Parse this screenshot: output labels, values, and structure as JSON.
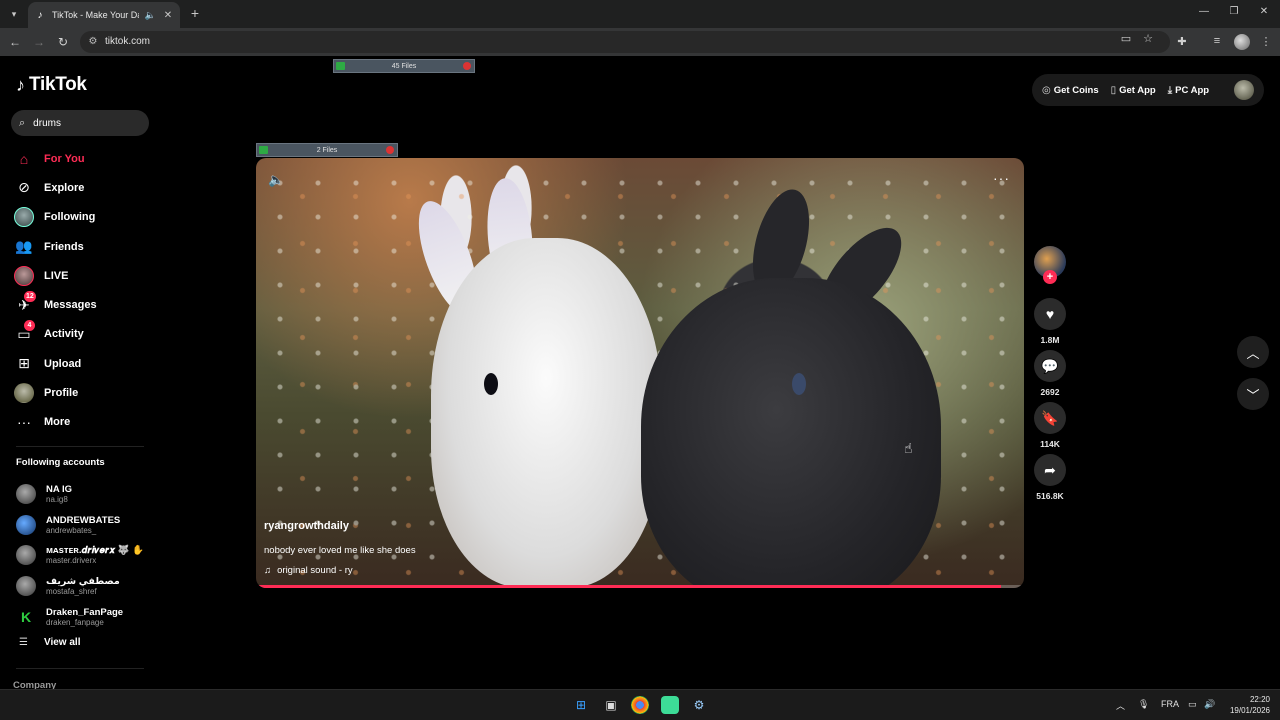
{
  "browser": {
    "tab_title": "TikTok - Make Your Day",
    "url": "tiktok.com"
  },
  "tiktok": {
    "logo_text": "TikTok",
    "search_value": "drums",
    "nav": [
      {
        "label": "For You",
        "icon": "home-icon"
      },
      {
        "label": "Explore",
        "icon": "compass-icon"
      },
      {
        "label": "Following",
        "icon": "following-avatar-icon"
      },
      {
        "label": "Friends",
        "icon": "friends-icon"
      },
      {
        "label": "LIVE",
        "icon": "live-avatar-icon"
      },
      {
        "label": "Messages",
        "icon": "messages-icon",
        "badge": "12"
      },
      {
        "label": "Activity",
        "icon": "activity-icon",
        "badge": "4"
      },
      {
        "label": "Upload",
        "icon": "upload-icon"
      },
      {
        "label": "Profile",
        "icon": "profile-avatar-icon"
      },
      {
        "label": "More",
        "icon": "more-dots-icon"
      }
    ],
    "following_accounts_title": "Following accounts",
    "following_accounts": [
      {
        "name": "NA IG",
        "handle": "na.ig8"
      },
      {
        "name": "ANDREWBATES",
        "handle": "andrewbates_"
      },
      {
        "name": "ᴍᴀsᴛᴇʀ.𝒅𝒓𝒊𝒗𝒆𝒓𝒙 🐺 ✋",
        "handle": "master.driverx"
      },
      {
        "name": "مصطفي شريف",
        "handle": "mostafa_shref"
      },
      {
        "name": "Draken_FanPage",
        "handle": "draken_fanpage"
      }
    ],
    "view_all": "View all",
    "company": "Company",
    "top_actions": {
      "get_coins": "Get Coins",
      "get_app": "Get App",
      "pc_app": "PC App"
    },
    "overlay_top": "45 Files",
    "overlay_video": "2 Files",
    "video": {
      "author": "ryangrowthdaily",
      "caption": "nobody ever loved me like she does",
      "sound": "original sound - ry",
      "progress": 0.97
    },
    "actions": {
      "likes": "1.8M",
      "comments": "2692",
      "saves": "114K",
      "shares": "516.8K"
    }
  },
  "taskbar": {
    "language": "FRA",
    "time": "22:20",
    "date": "19/01/2026"
  },
  "colors": {
    "accent": "#fe2c55",
    "page_bg": "#000000"
  }
}
